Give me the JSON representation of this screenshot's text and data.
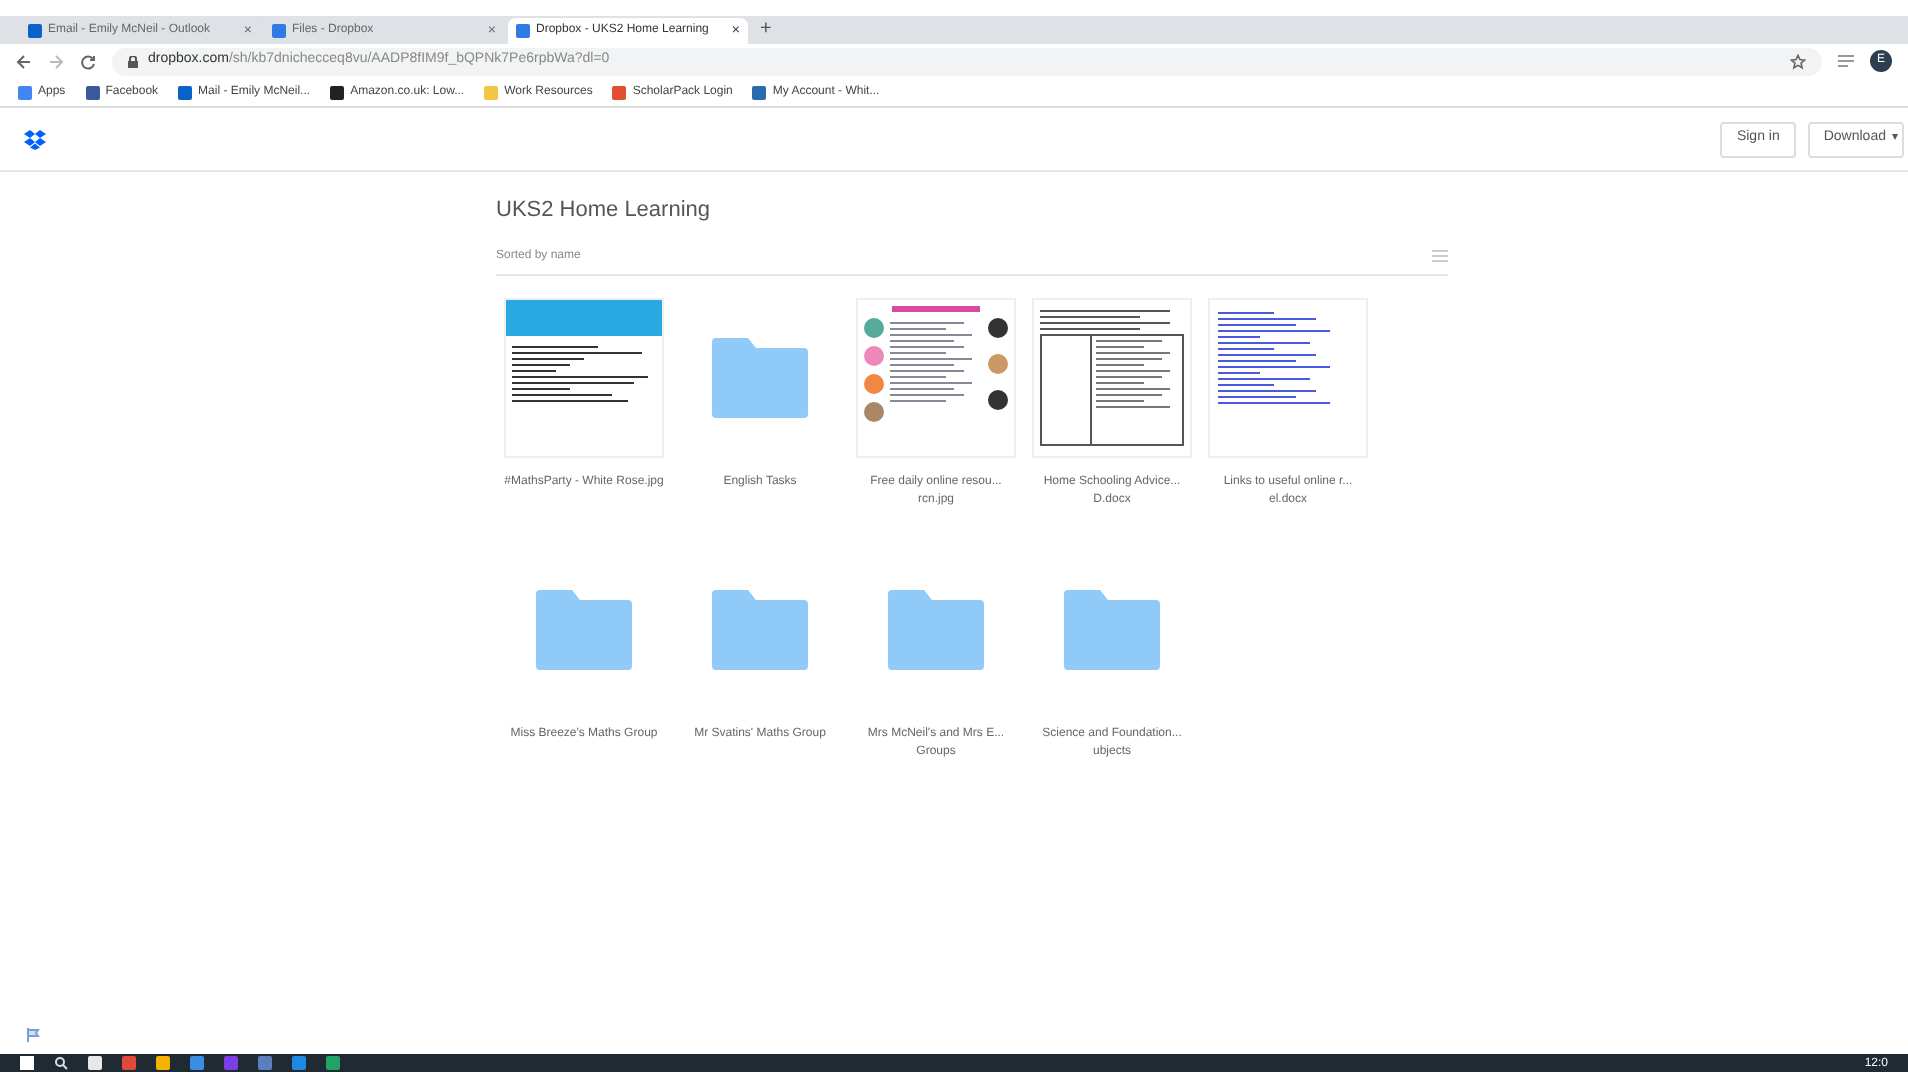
{
  "browser": {
    "tabs": [
      {
        "title": "Email - Emily McNeil - Outlook",
        "close": "×",
        "selected": false
      },
      {
        "title": "Files - Dropbox",
        "close": "×",
        "selected": false
      },
      {
        "title": "Dropbox - UKS2 Home Learning",
        "close": "×",
        "selected": true
      }
    ],
    "new_tab": "+",
    "url_host": "dropbox.com",
    "url_path": "/sh/kb7dnichecceq8vu/AADP8fIM9f_bQPNk7Pe6rpbWa?dl=0",
    "profile_initial": "E",
    "bookmarks": [
      {
        "label": "Apps",
        "color": "#4285f4"
      },
      {
        "label": "Facebook",
        "color": "#3b5998"
      },
      {
        "label": "Mail - Emily McNeil...",
        "color": "#0a64c8"
      },
      {
        "label": "Amazon.co.uk: Low...",
        "color": "#222222"
      },
      {
        "label": "Work Resources",
        "color": "#f4c542"
      },
      {
        "label": "ScholarPack Login",
        "color": "#e05030"
      },
      {
        "label": "My Account - Whit...",
        "color": "#2a6ab0"
      }
    ]
  },
  "header": {
    "sign_in": "Sign in",
    "download": "Download",
    "download_caret": "▾"
  },
  "folder": {
    "title": "UKS2 Home Learning",
    "sort_label": "Sorted by name",
    "items": [
      {
        "kind": "image",
        "name": "#MathsParty - White Rose.jpg"
      },
      {
        "kind": "folder",
        "name": "English Tasks"
      },
      {
        "kind": "collage",
        "name": "Free daily online resou... rcn.jpg"
      },
      {
        "kind": "table-doc",
        "name": "Home Schooling Advice... D.docx"
      },
      {
        "kind": "link-doc",
        "name": "Links to useful online r... el.docx"
      },
      {
        "kind": "folder",
        "name": "Miss Breeze's Maths Group"
      },
      {
        "kind": "folder",
        "name": "Mr Svatins' Maths Group"
      },
      {
        "kind": "folder",
        "name": "Mrs McNeil's and Mrs E... Groups"
      },
      {
        "kind": "folder",
        "name": "Science and Foundation... ubjects"
      }
    ]
  },
  "taskbar": {
    "apps": [
      {
        "color": "#e8e8e8"
      },
      {
        "color": "#e04a3a"
      },
      {
        "color": "#f2b400"
      },
      {
        "color": "#3a8ee6"
      },
      {
        "color": "#7b3fe4"
      },
      {
        "color": "#5a7fbf"
      },
      {
        "color": "#1e88e5"
      },
      {
        "color": "#21a366"
      }
    ],
    "clock": "12:0"
  }
}
